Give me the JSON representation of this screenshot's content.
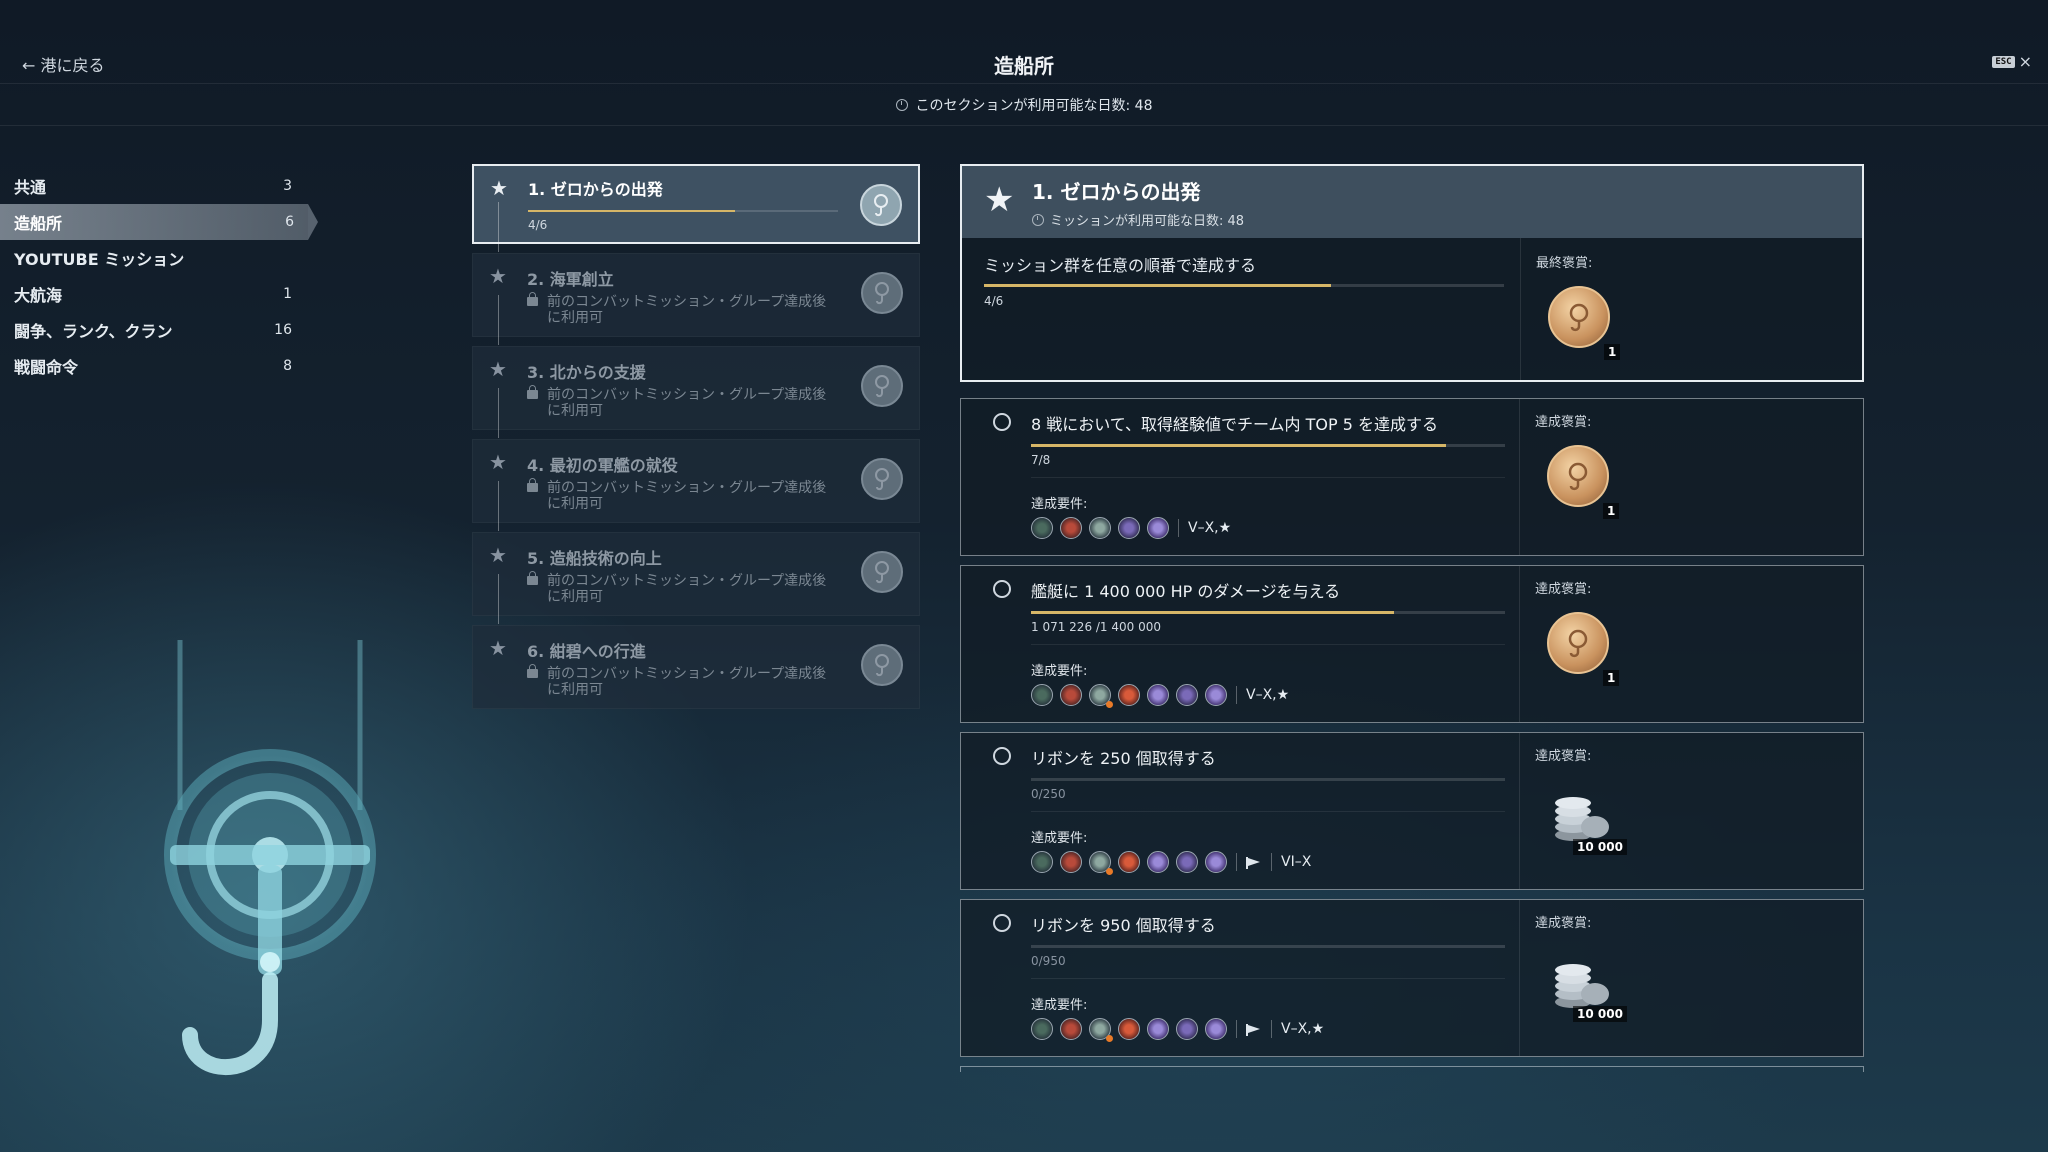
{
  "header": {
    "back_label": "← 港に戻る",
    "title": "造船所",
    "esc_label": "ESC",
    "close_label": "×",
    "days_available": "このセクションが利用可能な日数: 48"
  },
  "sidebar": {
    "items": [
      {
        "label": "共通",
        "count": "3"
      },
      {
        "label": "造船所",
        "count": "6",
        "active": true
      },
      {
        "label": "YOUTUBE ミッション",
        "count": ""
      },
      {
        "label": "大航海",
        "count": "1"
      },
      {
        "label": "闘争、ランク、クラン",
        "count": "16"
      },
      {
        "label": "戦闘命令",
        "count": "8"
      }
    ]
  },
  "groups": [
    {
      "name": "1. ゼロからの出発",
      "progress": "4/6",
      "progress_fraction": 0.6667,
      "active": true
    },
    {
      "name": "2. 海軍創立",
      "locked_text": "前のコンバットミッション・グループ達成後に利用可"
    },
    {
      "name": "3. 北からの支援",
      "locked_text": "前のコンバットミッション・グループ達成後に利用可"
    },
    {
      "name": "4. 最初の軍艦の就役",
      "locked_text": "前のコンバットミッション・グループ達成後に利用可"
    },
    {
      "name": "5. 造船技術の向上",
      "locked_text": "前のコンバットミッション・グループ達成後に利用可"
    },
    {
      "name": "6. 紺碧への行進",
      "locked_text": "前のコンバットミッション・グループ達成後に利用可"
    }
  ],
  "detail": {
    "title": "1. ゼロからの出発",
    "days": "ミッションが利用可能な日数: 48",
    "task": "ミッション群を任意の順番で達成する",
    "progress": "4/6",
    "progress_fraction": 0.6667,
    "final_reward_label": "最終褒賞:",
    "final_reward_qty": "1"
  },
  "missions": [
    {
      "title": "8 戦において、取得経験値でチーム内 TOP 5 を達成する",
      "progress": "7/8",
      "progress_fraction": 0.875,
      "req_label": "達成要件:",
      "req_tiers": "V–X,★",
      "reward_label": "達成褒賞:",
      "reward_qty": "1",
      "reward_type": "coin"
    },
    {
      "title": "艦艇に 1 400 000 HP のダメージを与える",
      "progress": "1 071 226 /1 400 000",
      "progress_fraction": 0.765,
      "req_label": "達成要件:",
      "req_tiers": "V–X,★",
      "reward_label": "達成褒賞:",
      "reward_qty": "1",
      "reward_type": "coin"
    },
    {
      "title": "リボンを 250 個取得する",
      "progress": "0/250",
      "progress_fraction": 0,
      "req_label": "達成要件:",
      "req_tiers": "VI–X",
      "reward_label": "達成褒賞:",
      "reward_qty": "10 000",
      "reward_type": "credits"
    },
    {
      "title": "リボンを 950 個取得する",
      "progress": "0/950",
      "progress_fraction": 0,
      "req_label": "達成要件:",
      "req_tiers": "V–X,★",
      "reward_label": "達成褒賞:",
      "reward_qty": "10 000",
      "reward_type": "credits"
    }
  ]
}
